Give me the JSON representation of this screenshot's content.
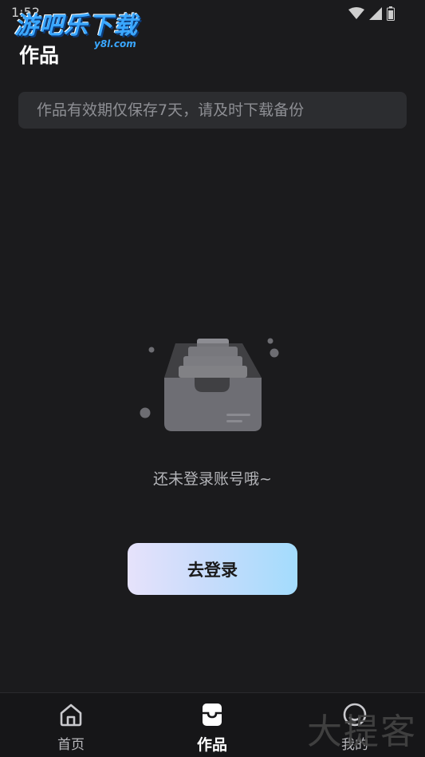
{
  "status_bar": {
    "time": "1:52"
  },
  "watermark": {
    "logo": "游吧乐下载",
    "logo_sub": "y8l.com",
    "corner": "大提客"
  },
  "header": {
    "title": "作品"
  },
  "notice": {
    "text": "作品有效期仅保存7天，请及时下载备份"
  },
  "empty_state": {
    "message": "还未登录账号哦~",
    "icon": "inbox-tray-icon"
  },
  "actions": {
    "login_label": "去登录"
  },
  "bottom_nav": {
    "items": [
      {
        "label": "首页",
        "icon": "home-icon"
      },
      {
        "label": "作品",
        "icon": "works-tray-icon",
        "active": true
      },
      {
        "label": "我的",
        "icon": "profile-icon"
      }
    ]
  },
  "colors": {
    "background": "#1b1b1d",
    "notice_bg": "#2c2d30",
    "button_gradient_start": "#e6e2fb",
    "button_gradient_end": "#a3dcfd"
  }
}
